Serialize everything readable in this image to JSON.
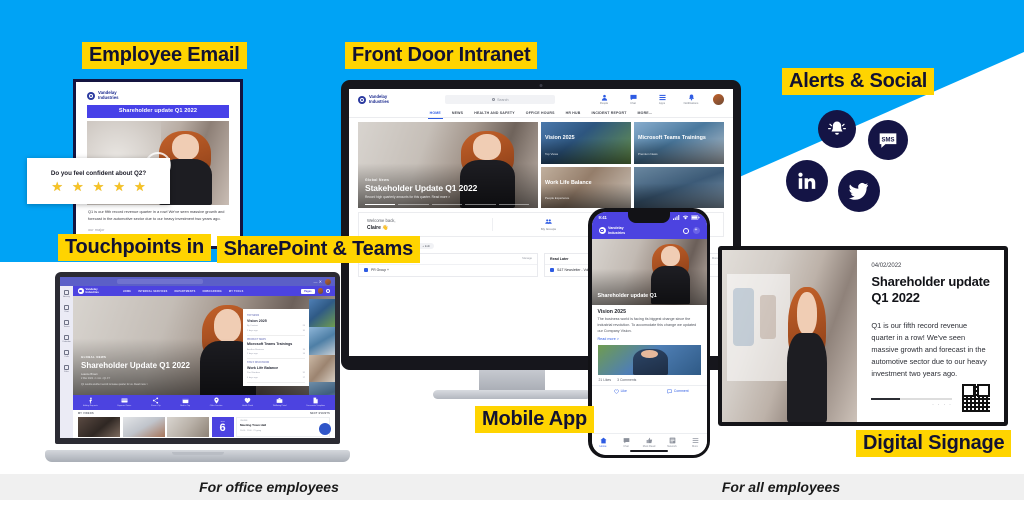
{
  "brand": {
    "name_line1": "Vandelay",
    "name_line2": "Industries",
    "accent_blue": "#00A3F5",
    "accent_yellow": "#FFD400",
    "navy": "#141445",
    "purple": "#4C43E0"
  },
  "labels": {
    "employee_email": "Employee Email",
    "front_door_intranet": "Front Door Intranet",
    "alerts_social": "Alerts & Social",
    "touchpoints": "Touchpoints in\nSharePoint & Teams",
    "touchpoints_line1": "Touchpoints in",
    "touchpoints_line2": "SharePoint & Teams",
    "mobile_app": "Mobile App",
    "digital_signage": "Digital Signage"
  },
  "footer": {
    "left": "For office employees",
    "right": "For all employees"
  },
  "email": {
    "banner_title": "Shareholder update Q1 2022",
    "body": "Q1 is our fifth record revenue quarter in a row! We've seen massive growth and forecast in the automotive sector due to our heavy investment two years ago.",
    "body_faint": "our major",
    "play_icon": "play-icon"
  },
  "rating": {
    "question": "Do you feel confident about Q2?",
    "star_glyph": "★",
    "star_count": 5,
    "star_color": "#F7C325"
  },
  "intranet": {
    "search_placeholder": "Search",
    "tools": [
      {
        "label": "People",
        "icon": "people-icon",
        "glyph": "A"
      },
      {
        "label": "Chat",
        "icon": "chat-icon",
        "glyph": "B"
      },
      {
        "label": "Apps",
        "icon": "apps-icon",
        "glyph": "C"
      },
      {
        "label": "Notifications",
        "icon": "bell-icon",
        "glyph": "D"
      }
    ],
    "nav": [
      "HOME",
      "NEWS",
      "HEALTH AND SAFETY",
      "OFFICE HOURS",
      "HR HUB",
      "INCIDENT REPORT",
      "MORE..."
    ],
    "hero": {
      "kicker": "Global News",
      "title": "Stakeholder Update Q1 2022",
      "subtitle": "Record high quarterly amounts for this quarter. Read more >"
    },
    "cards": [
      {
        "title": "Vision 2025",
        "meta": "Top Views"
      },
      {
        "title": "Microsoft Teams Trainings",
        "meta": "Premium News"
      },
      {
        "title": "Work Life Balance",
        "meta": "People Experience"
      },
      {
        "title": "",
        "meta": ""
      }
    ],
    "welcome": {
      "line1": "Welcome back,",
      "line2": "Claire 👋",
      "quick": [
        {
          "label": "My Groups",
          "icon": "groups-icon"
        },
        {
          "label": "Emergency contacts",
          "icon": "warning-icon"
        }
      ]
    },
    "bookmarks_section": {
      "title": "Bookmarks & Groups",
      "pill": "+ Edit",
      "columns": [
        {
          "header": "Bookmarks",
          "action": "Manage",
          "item": "PR Group +"
        },
        {
          "header": "Read Later",
          "action": "More",
          "item": "S&T Newsletter - Volume 2"
        }
      ]
    }
  },
  "sharepoint": {
    "teams_rail": [
      {
        "label": "Activity",
        "icon": "activity-icon"
      },
      {
        "label": "Chat",
        "icon": "chat-icon"
      },
      {
        "label": "Teams",
        "icon": "teams-icon"
      },
      {
        "label": "Calendar",
        "icon": "calendar-icon"
      },
      {
        "label": "Calls",
        "icon": "calls-icon"
      },
      {
        "label": "Files",
        "icon": "files-icon"
      }
    ],
    "nav": [
      "HOME",
      "INTERNAL SERVICES",
      "DEPARTMENTS",
      "ONBOARDING",
      "MY TOOLS"
    ],
    "nav_button": "Pages",
    "hero": {
      "kicker": "GLOBAL NEWS",
      "title": "Shareholder Update Q1 2022",
      "author": "Leanne Brown",
      "date": "2 Mar 2022  •  1 min  •  Q1 FY",
      "excerpt": "Q1 results another record increase quarter for us. Read more >"
    },
    "panel": [
      {
        "kicker": "TOP NEWS",
        "title": "Vision 2025",
        "meta_left": "By Content",
        "meta_date": "2 days ago",
        "likes": "24",
        "comments": "10"
      },
      {
        "kicker": "PRODUCT NEWS",
        "title": "Microsoft Teams Trainings",
        "meta_left": "Another Business",
        "meta_date": "2 days ago",
        "likes": "15",
        "comments": "14"
      },
      {
        "kicker": "STAFF DISCUSSION",
        "title": "Work Life Balance",
        "meta_left": "Paul Sanders",
        "meta_date": "4 days ago",
        "likes": "31",
        "comments": "17"
      }
    ],
    "icon_row": [
      {
        "label": "Holiday Requests",
        "icon": "holiday-icon",
        "glyph": "🏃"
      },
      {
        "label": "Expense Claims",
        "icon": "expense-icon",
        "glyph": "💳"
      },
      {
        "label": "Share a Tip",
        "icon": "share-icon",
        "glyph": "🔗"
      },
      {
        "label": "Book a Trip",
        "icon": "booking-icon",
        "glyph": "📅"
      },
      {
        "label": "Office Location",
        "icon": "location-icon",
        "glyph": "📍"
      },
      {
        "label": "Health Portal",
        "icon": "health-icon",
        "glyph": "♡"
      },
      {
        "label": "Wellbeing Portal",
        "icon": "wellbeing-icon",
        "glyph": "🧰"
      },
      {
        "label": "Documents Templates",
        "icon": "documents-icon",
        "glyph": "📄"
      }
    ],
    "bottom": {
      "left_header": "MY VIDEOS",
      "right_header": "NEXT EVENTS",
      "event": {
        "month": "JUN",
        "day": "6",
        "kicker": "ONLINE",
        "title": "Meeting Town Hall",
        "meta": "10:00 - 11:00 · 21 going"
      }
    }
  },
  "mobile": {
    "status_time": "9:41",
    "status_icons": "signal-wifi-battery",
    "hero_title": "Shareholder update Q1",
    "article": {
      "title": "Vision 2025",
      "body": "The business world is facing its biggest change since the industrial revolution. To accomodate this change we updated our Company Vision.",
      "read_more": "Read more >"
    },
    "engagement": {
      "likes": "21 Likes",
      "comments": "3 Comments"
    },
    "actions": [
      {
        "label": "Like",
        "icon": "thumbs-up-icon",
        "glyph": "♡"
      },
      {
        "label": "Comment",
        "icon": "comment-icon",
        "glyph": "▢"
      }
    ],
    "tabs": [
      {
        "label": "Home",
        "icon": "home-icon",
        "glyph": "⌂",
        "active": true
      },
      {
        "label": "Chat",
        "icon": "chat-icon",
        "glyph": "✎",
        "active": false
      },
      {
        "label": "Must Read",
        "icon": "must-read-icon",
        "glyph": "👍",
        "active": false
      },
      {
        "label": "Network",
        "icon": "network-icon",
        "glyph": "▤",
        "active": false
      },
      {
        "label": "More",
        "icon": "menu-icon",
        "glyph": "☰",
        "active": false
      }
    ]
  },
  "signage": {
    "date": "04/02/2022",
    "title_line1": "Shareholder update",
    "title_line2": "Q1 2022",
    "body": "Q1 is our fifth record revenue quarter in a row! We've seen massive growth and forecast in the automotive sector due to our heavy investment two years ago.",
    "pager": "· · · ·",
    "progress_percent": 36,
    "qr": "qr-code"
  },
  "social": [
    {
      "name": "alert-bell",
      "label": ""
    },
    {
      "name": "sms",
      "label": "SMS"
    },
    {
      "name": "linkedin",
      "label": "in"
    },
    {
      "name": "twitter",
      "label": ""
    }
  ]
}
